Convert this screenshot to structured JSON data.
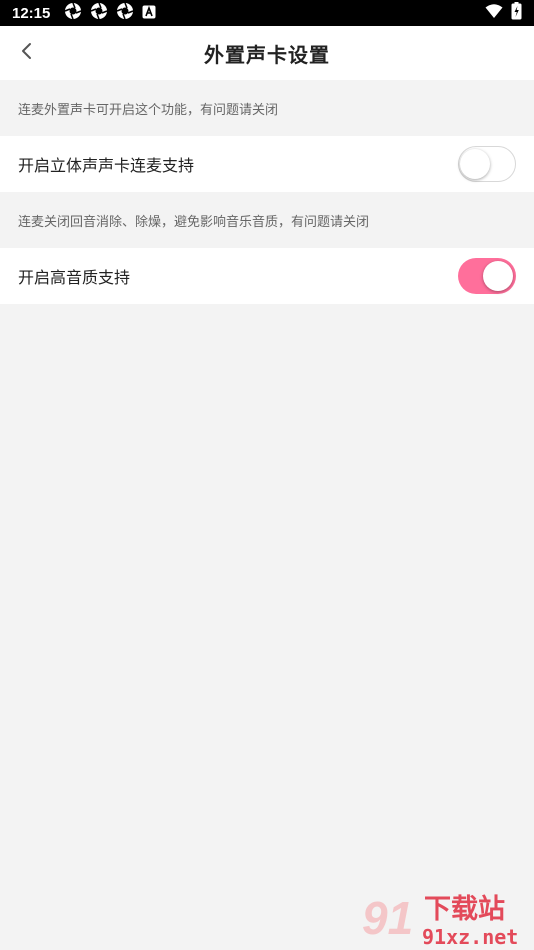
{
  "status_bar": {
    "time": "12:15",
    "left_icons": [
      "aperture-icon",
      "aperture-icon",
      "aperture-icon",
      "a-badge-icon"
    ],
    "right_icons": [
      "wifi-icon",
      "battery-charging-icon"
    ]
  },
  "header": {
    "title": "外置声卡设置",
    "back_icon": "chevron-left-icon"
  },
  "sections": [
    {
      "hint": "连麦外置声卡可开启这个功能，有问题请关闭",
      "label": "开启立体声声卡连麦支持",
      "enabled": false
    },
    {
      "hint": "连麦关闭回音消除、除燥，避免影响音乐音质，有问题请关闭",
      "label": "开启高音质支持",
      "enabled": true
    }
  ],
  "watermark": {
    "text": "下载站",
    "domain": "91xz.net",
    "logo_text": "91"
  },
  "colors": {
    "accent": "#ff6f9b",
    "background": "#f3f3f3"
  }
}
